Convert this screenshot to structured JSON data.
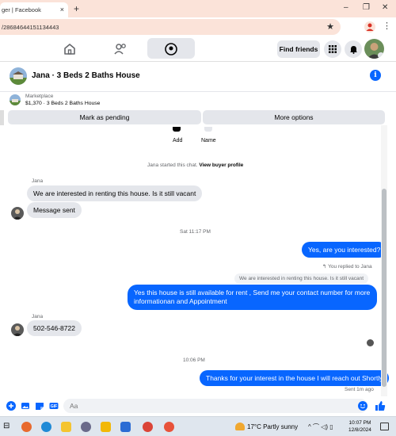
{
  "browser": {
    "tab_title": "ger | Facebook",
    "close_glyph": "×",
    "new_tab_glyph": "+",
    "url": "/28684644151134443",
    "minimize_glyph": "–",
    "maximize_glyph": "❐",
    "close_window_glyph": "✕"
  },
  "fb_nav": {
    "find_friends_label": "Find friends"
  },
  "conversation": {
    "title": "Jana · 3 Beds 2 Baths House",
    "info_glyph": "i"
  },
  "listing": {
    "source": "Marketplace",
    "summary": "$1,370 · 3 Beds 2 Baths House"
  },
  "actions": {
    "mark_pending": "Mark as pending",
    "more_options": "More options"
  },
  "chat": {
    "add_label": "Add",
    "name_label": "Name",
    "system_started": "Jana started this chat.",
    "system_link": "View buyer profile",
    "sender_1": "Jana",
    "msg_1": "We are interested in renting this house. Is it still vacant",
    "msg_2": "Message sent",
    "time_1": "Sat 11:17 PM",
    "msg_3": "Yes, are you interested?",
    "replied_to": "You replied to Jana",
    "quoted": "We are interested in renting this house. Is it still vacant",
    "msg_4": "Yes this house is still available for rent , Send me your contact number for more informationan and Appointment",
    "sender_2": "Jana",
    "msg_5": "502-546-8722",
    "time_2": "10:06 PM",
    "msg_6": "Thanks for your interest in the house I will reach out Shortly",
    "sent_status": "Sent 1m ago"
  },
  "composer": {
    "placeholder": "Aa"
  },
  "taskbar": {
    "weather": "17°C  Partly sunny",
    "time": "10:07 PM",
    "date": "12/8/2024",
    "tray_glyphs": "^  ⌒  ◁)  ▯"
  },
  "colors": {
    "messenger_blue": "#0866ff",
    "bubble_grey": "#e4e6eb",
    "tab_strip": "#fbe3d9"
  }
}
